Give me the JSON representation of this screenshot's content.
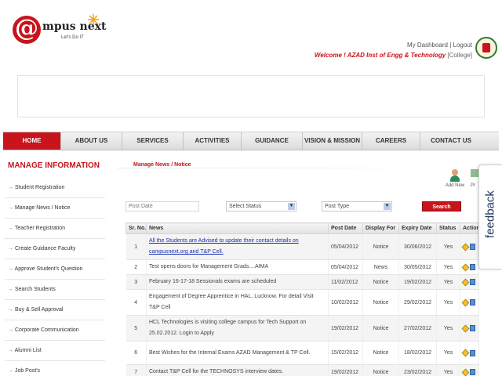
{
  "header": {
    "logo_at": "@",
    "logo_name": "mpus next",
    "logo_tagline": "Let's Do IT",
    "links": {
      "dashboard": "My Dashboard",
      "separator": "|",
      "logout": "Logout"
    },
    "welcome": "Welcome ! AZAD Inst of Engg & Technology",
    "role": "[College]"
  },
  "nav": {
    "items": [
      {
        "label": "HOME"
      },
      {
        "label": "ABOUT US"
      },
      {
        "label": "SERVICES"
      },
      {
        "label": "ACTIVITIES"
      },
      {
        "label": "GUIDANCE"
      },
      {
        "label": "VISION & MISSION"
      },
      {
        "label": "CAREERS"
      },
      {
        "label": "CONTACT US"
      }
    ],
    "active": "HOME"
  },
  "sidebar": {
    "title": "MANAGE INFORMATION",
    "items": [
      "Student Registration",
      "Manage News / Notice",
      "Teacher Registration",
      "Create Guidance Faculty",
      "Approve Student's Question",
      "Search Students",
      "Buy & Sell Approval",
      "Corporate Communication",
      "Alumni List",
      "Job Post's"
    ]
  },
  "main": {
    "title": "Manage News / Notice",
    "add_new": "Add New",
    "print_cut": "Pr",
    "filters": {
      "post_date_placeholder": "Post Date",
      "status_select": "Select Status",
      "type_select": "Post Type",
      "search_button": "Search"
    },
    "table": {
      "headers": [
        "Sr. No.",
        "News",
        "Post Date",
        "Display For",
        "Expiry Date",
        "Status",
        "Action"
      ],
      "rows": [
        {
          "sr": "1",
          "news": "All the Students are Advised to update their contact details on campusnext.org and T&P Cell.",
          "post": "05/04/2012",
          "display": "Notice",
          "expiry": "30/06/2012",
          "status": "Yes",
          "link": true
        },
        {
          "sr": "2",
          "news": "Test opens doors for Management Grads....AIMA",
          "post": "05/04/2012",
          "display": "News",
          "expiry": "30/05/2012",
          "status": "Yes"
        },
        {
          "sr": "3",
          "news": "February 16-17-18 Sessionals exams are scheduled",
          "post": "11/02/2012",
          "display": "Notice",
          "expiry": "19/02/2012",
          "status": "Yes"
        },
        {
          "sr": "4",
          "news": "Engagement of Degree Apprentice in HAL, Lucknow. For detail Visit T&P Cell",
          "post": "10/02/2012",
          "display": "Notice",
          "expiry": "29/02/2012",
          "status": "Yes"
        },
        {
          "sr": "5",
          "news": "HCL Technologies is visiting college campus for Tech Support on 25.02.2012. Login to Apply",
          "post": "19/02/2012",
          "display": "Notice",
          "expiry": "27/02/2012",
          "status": "Yes"
        },
        {
          "sr": "6",
          "news": "Best Wishes for the Internal Exams AZAD Management & TP Cell.",
          "post": "15/02/2012",
          "display": "Notice",
          "expiry": "18/02/2012",
          "status": "Yes"
        },
        {
          "sr": "7",
          "news": "Contact T&P Cell for the TECHNOSYS interview dates.",
          "post": "19/02/2012",
          "display": "Notice",
          "expiry": "23/02/2012",
          "status": "Yes"
        }
      ]
    }
  },
  "feedback": {
    "label": "feedback"
  },
  "colors": {
    "brand_red": "#c8141c",
    "link_blue": "#1a2fb0"
  }
}
